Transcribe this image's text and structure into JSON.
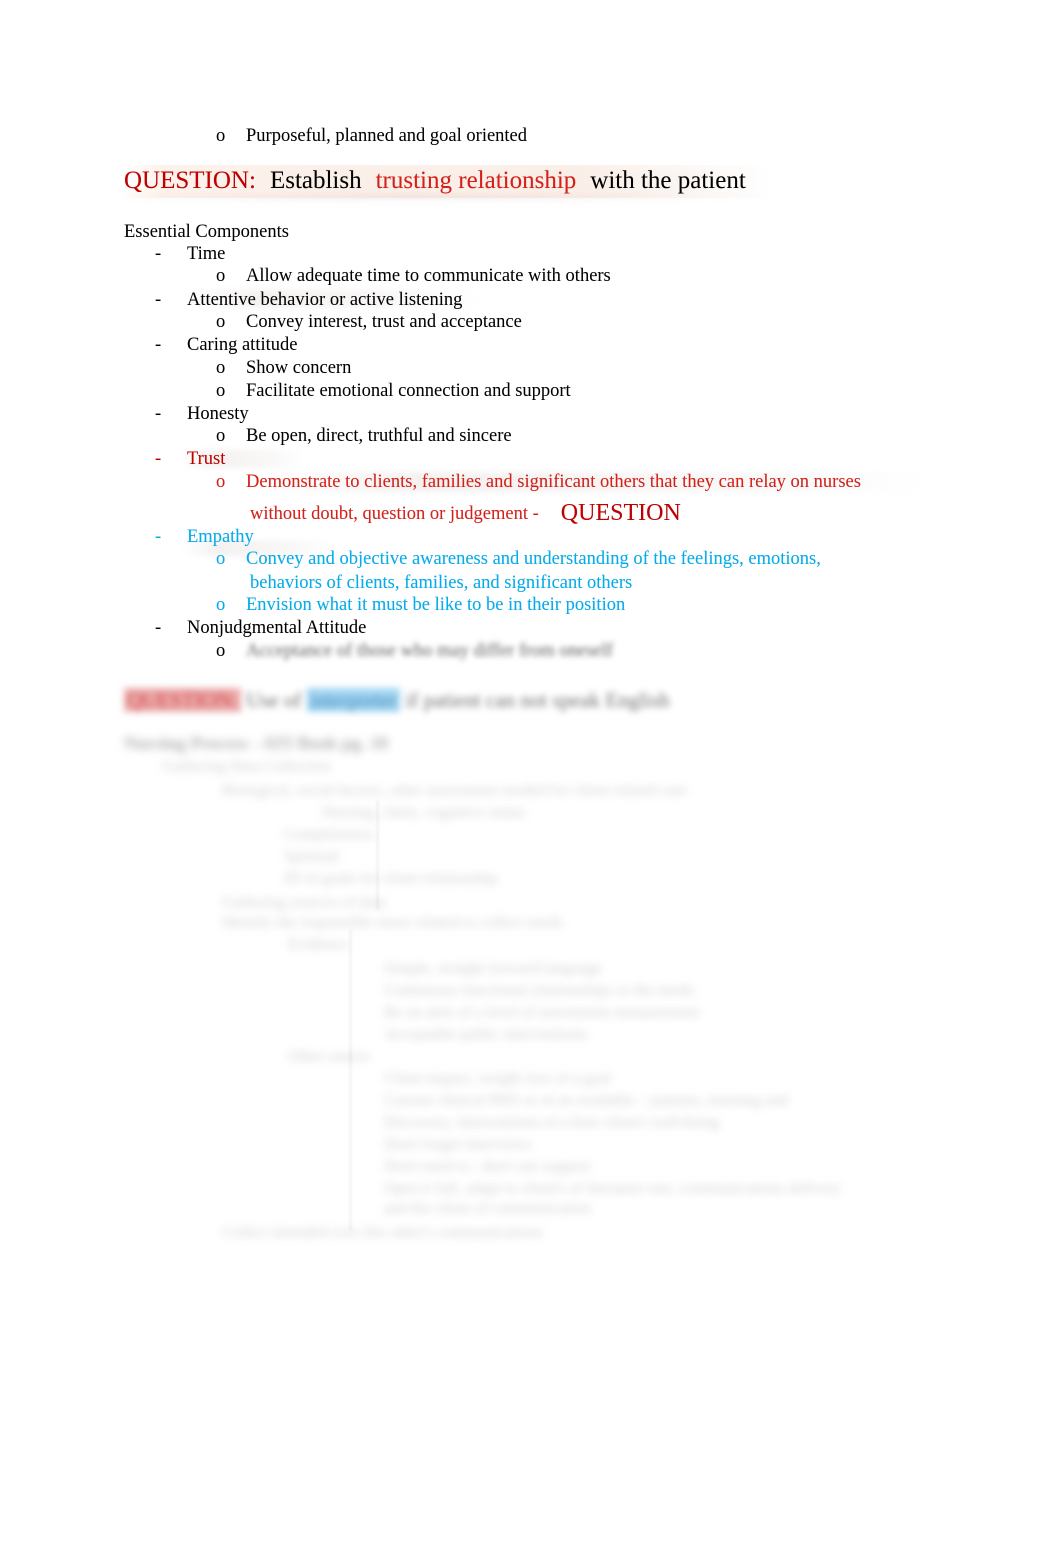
{
  "document": {
    "page_background": "#ffffff",
    "colors": {
      "dark_red": "#C00000",
      "red": "#D91E18",
      "blue": "#00AEEF",
      "black": "#000000"
    }
  },
  "top_bullet": {
    "marker": "o",
    "text": "Purposeful, planned and goal oriented"
  },
  "question_header": {
    "label": "QUESTION:",
    "part_black_1": "Establish",
    "part_red": "trusting relationship",
    "part_black_2": "with the patient"
  },
  "essential_components": {
    "heading": "Essential Components",
    "items": [
      {
        "marker": "-",
        "label": "Time",
        "color": "black",
        "subitems": [
          {
            "marker": "o",
            "text": "Allow adequate time to communicate with others",
            "color": "black"
          }
        ]
      },
      {
        "marker": "-",
        "label": "Attentive behavior or active listening",
        "color": "black",
        "subitems": [
          {
            "marker": "o",
            "text": "Convey interest, trust and acceptance",
            "color": "black"
          }
        ]
      },
      {
        "marker": "-",
        "label": "Caring attitude",
        "color": "black",
        "subitems": [
          {
            "marker": "o",
            "text": "Show concern",
            "color": "black"
          },
          {
            "marker": "o",
            "text": "Facilitate emotional connection and support",
            "color": "black"
          }
        ]
      },
      {
        "marker": "-",
        "label": "Honesty",
        "color": "black",
        "subitems": [
          {
            "marker": "o",
            "text": "Be open, direct, truthful and sincere",
            "color": "black"
          }
        ]
      },
      {
        "marker": "-",
        "label": "Trust",
        "color": "dark_red",
        "subitems": [
          {
            "marker": "o",
            "text_line_1": "Demonstrate to clients, families and significant others that they can relay on nurses",
            "text_line_2": "without doubt, question or judgement -",
            "emphasis": "QUESTION",
            "color": "dark_red"
          }
        ]
      },
      {
        "marker": "-",
        "label": "Empathy",
        "color": "blue",
        "subitems": [
          {
            "marker": "o",
            "text_line_1": "Convey and objective awareness and understanding of the feelings, emotions,",
            "text_line_2": "behaviors of clients, families, and significant others",
            "color": "blue"
          },
          {
            "marker": "o",
            "text": "Envision what it must be like to be in their position",
            "color": "blue"
          }
        ]
      },
      {
        "marker": "-",
        "label": "Nonjudgmental Attitude",
        "color": "black",
        "subitems": [
          {
            "marker": "o",
            "text": "Acceptance of those who may differ from oneself",
            "color": "black",
            "blurred": true
          }
        ]
      }
    ]
  },
  "blurred_section": {
    "note": "illegible / blurred region of the page",
    "question_line": {
      "label": "QUESTION:",
      "part_black_1": "Use of",
      "part_blue": "interpreter",
      "part_black_2": "if patient can not speak English"
    },
    "heading": "Nursing Process - ATI Book pg. 18",
    "lines": [
      {
        "indent": 1,
        "marker": "1.",
        "text": "Gathering Data Collection"
      },
      {
        "indent": 2,
        "marker": "a.",
        "text": "Biological, social factors, other assessment needed for client related care"
      },
      {
        "indent": 3,
        "marker": "",
        "text": "Nursing, client, cognitive status"
      },
      {
        "indent": 3,
        "marker": "i.",
        "text": "Completeness"
      },
      {
        "indent": 3,
        "marker": "ii.",
        "text": "Spiritual"
      },
      {
        "indent": 3,
        "marker": "iii.",
        "text": "ID of goals for client relationship"
      },
      {
        "indent": 2,
        "marker": "b.",
        "text": "Gathering sources of data"
      },
      {
        "indent": 2,
        "marker": "c.",
        "text": "Identify the responsible nurse related to collect needs"
      },
      {
        "indent": 3,
        "marker": "i.",
        "text": "Evidence"
      },
      {
        "indent": 4,
        "marker": "",
        "text": "Simple, straight forward language"
      },
      {
        "indent": 4,
        "marker": "",
        "text": "Continuous functional relationships or the needs"
      },
      {
        "indent": 4,
        "marker": "",
        "text": "Be on alert of a level of assessment measurement"
      },
      {
        "indent": 4,
        "marker": "",
        "text": "Acceptable public interventions"
      },
      {
        "indent": 3,
        "marker": "ii.",
        "text": "Other source"
      },
      {
        "indent": 4,
        "marker": "",
        "text": "Client impact, weight loss of a goal"
      },
      {
        "indent": 4,
        "marker": "",
        "text": "Current clinical PRN or of an available – patients, learning and"
      },
      {
        "indent": 4,
        "marker": "",
        "text": "Discovery, interventions of a best client's well-being"
      },
      {
        "indent": 4,
        "marker": "",
        "text": "Don't forget interviews"
      },
      {
        "indent": 4,
        "marker": "",
        "text": "Don't need to / don't use support"
      },
      {
        "indent": 4,
        "marker": "",
        "text": "Open it full, adapt to client's of literature test, communications delivery"
      },
      {
        "indent": 4,
        "marker": "",
        "text": "and the client of communication"
      },
      {
        "indent": 2,
        "marker": "d.",
        "text": "Collect intended over this other's communications"
      }
    ]
  }
}
